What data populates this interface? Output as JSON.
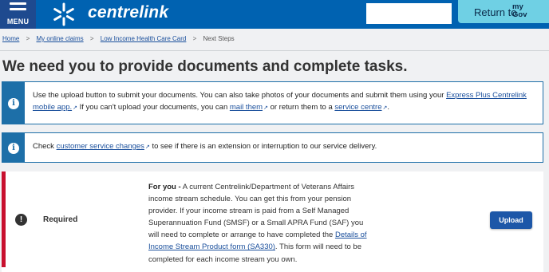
{
  "header": {
    "menu_label": "MENU",
    "logo_text": "centrelink",
    "search_value": "",
    "return_label": "Return to",
    "mygov_line1": "my",
    "mygov_line2": "Gov"
  },
  "breadcrumb": {
    "home": "Home",
    "claims": "My online claims",
    "claim": "Low Income Health Care Card",
    "current": "Next Steps",
    "separator": ">"
  },
  "page_title": "We need you to provide documents and complete tasks.",
  "info_upload": {
    "part1": "Use the upload button to submit your documents. You can also take photos of your documents and submit them using your ",
    "link1": "Express Plus Centrelink mobile app.",
    "part2": " If you can't upload your documents, you can ",
    "link2": "mail them",
    "part3": " or return them to a ",
    "link3": "service centre",
    "part4": "."
  },
  "info_changes": {
    "part1": "Check ",
    "link1": "customer service changes",
    "part2": " to see if there is an extension or interruption to our service delivery."
  },
  "task": {
    "status": "Required",
    "lead": "For you -",
    "text1": " A current Centrelink/Department of Veterans Affairs income stream schedule. You can get this from your pension provider. If your income stream is paid from a Self Managed Superannuation Fund (SMSF) or a Small APRA Fund (SAF) you will need to complete or arrange to have completed the ",
    "link": "Details of Income Stream Product form (SA330)",
    "text2": ". This form will need to be completed for each income stream you own.",
    "button_label": "Upload"
  },
  "colors": {
    "header_blue": "#0062b1",
    "menu_blue": "#1e4a8f",
    "mygov_cyan": "#6fd0e4",
    "info_blue": "#1d6fa8",
    "required_red": "#c8102e",
    "button_blue": "#1d57a8"
  },
  "icons": {
    "info": "info-circle-icon",
    "required": "exclamation-circle-icon",
    "external": "external-link-icon"
  }
}
